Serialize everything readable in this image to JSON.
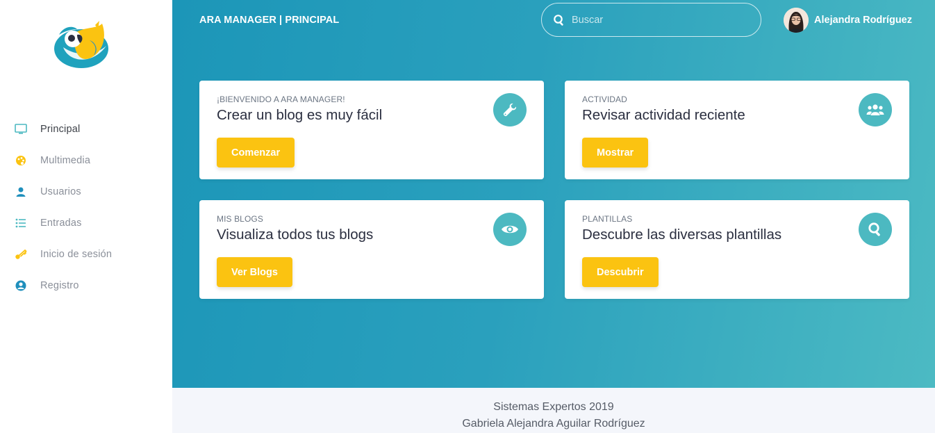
{
  "sidebar": {
    "logo_icon": "parrot-logo",
    "items": [
      {
        "label": "Principal",
        "icon": "monitor-icon",
        "active": true
      },
      {
        "label": "Multimedia",
        "icon": "palette-icon",
        "active": false
      },
      {
        "label": "Usuarios",
        "icon": "user-icon",
        "active": false
      },
      {
        "label": "Entradas",
        "icon": "list-icon",
        "active": false
      },
      {
        "label": "Inicio de sesión",
        "icon": "key-icon",
        "active": false
      },
      {
        "label": "Registro",
        "icon": "user-circle-icon",
        "active": false
      }
    ]
  },
  "header": {
    "title": "ARA MANAGER | PRINCIPAL",
    "search": {
      "placeholder": "Buscar",
      "value": ""
    },
    "user": {
      "name": "Alejandra Rodríguez"
    }
  },
  "cards": [
    {
      "kicker": "¡BIENVENIDO A ARA MANAGER!",
      "title": "Crear un blog es muy fácil",
      "button": "Comenzar",
      "icon": "wrench-icon"
    },
    {
      "kicker": "ACTIVIDAD",
      "title": "Revisar actividad reciente",
      "button": "Mostrar",
      "icon": "users-icon"
    },
    {
      "kicker": "MIS BLOGS",
      "title": "Visualiza todos tus blogs",
      "button": "Ver Blogs",
      "icon": "eye-icon"
    },
    {
      "kicker": "PLANTILLAS",
      "title": "Descubre las diversas plantillas",
      "button": "Descubrir",
      "icon": "search-icon"
    }
  ],
  "footer": {
    "line1": "Sistemas Expertos 2019",
    "line2": "Gabriela Alejandra Aguilar Rodríguez"
  },
  "colors": {
    "accent_yellow": "#fbc311",
    "icon_teal": "#4cb9c1",
    "gradient_start": "#1c96b8",
    "gradient_end": "#4cbac3"
  }
}
